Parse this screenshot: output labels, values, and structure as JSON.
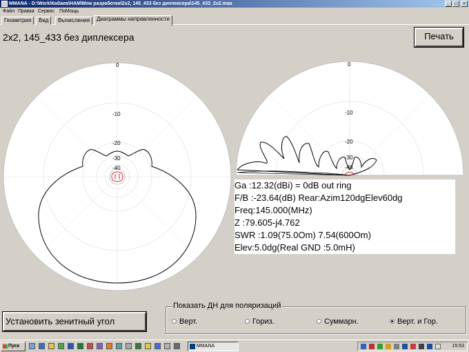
{
  "window": {
    "title": "MMANA - D:\\Work\\Кабаев\\НАМ\\Мои разработки\\2х2, 145_433 без диплексера\\145_433_2x2.maa"
  },
  "menu": [
    "Файл",
    "Правка",
    "Сервис",
    "ПоМощь"
  ],
  "tabs": [
    "Геометрия",
    "Вид",
    "Вычисления",
    "Диаграммы направленности"
  ],
  "active_tab": "Диаграммы направленности",
  "diagram": {
    "title": "2х2, 145_433 без диплексера",
    "print_label": "Печать"
  },
  "polar": {
    "ring_labels": [
      "0",
      "-10",
      "-20",
      "-30",
      "-40"
    ]
  },
  "info": {
    "lines": [
      "Ga :12.32(dBi) = 0dB  out ring",
      "F/B :-23.64(dB) Rear:Azim120dgElev60dg",
      "Freq:145.000(MHz)",
      "Z  :79.605-j4.762",
      "SWR :1.09(75.0Om) 7.54(600Om)",
      "Elev:5.0dg(Real GND :5.0mH)"
    ]
  },
  "zenith_button": "Установить зенитный угол",
  "polarization": {
    "legend": "Показать ДН для поляризаций",
    "options": [
      "Верт.",
      "Гориз.",
      "Суммарн.",
      "Верт. и Гор."
    ],
    "selected": "Верт. и Гор."
  },
  "taskbar": {
    "start_label": "Пуск",
    "task_label": "MMANA",
    "clock": "15:53"
  }
}
